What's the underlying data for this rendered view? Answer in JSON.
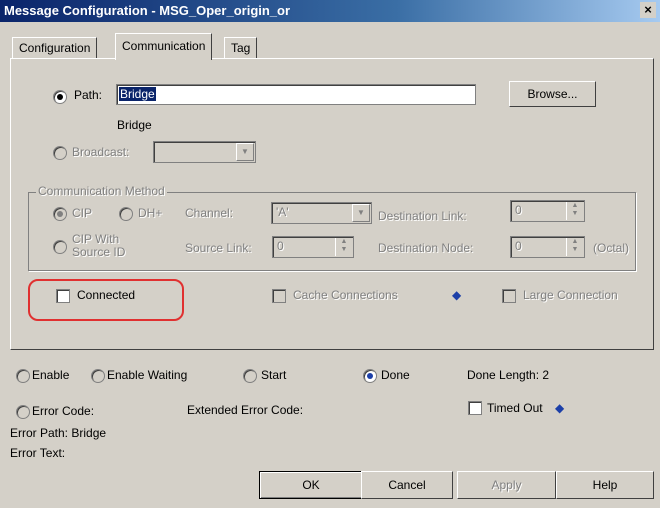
{
  "window": {
    "title": "Message Configuration - MSG_Oper_origin_or",
    "close_glyph": "×"
  },
  "tabs": [
    {
      "label": "Configuration"
    },
    {
      "label": "Communication"
    },
    {
      "label": "Tag"
    }
  ],
  "path": {
    "label": "Path:",
    "value": "Bridge",
    "resolved": "Bridge",
    "browse_label": "Browse..."
  },
  "broadcast": {
    "label": "Broadcast:"
  },
  "comm_method": {
    "group_label": "Communication Method",
    "cip_label": "CIP",
    "dhplus_label": "DH+",
    "cip_source_label_1": "CIP With",
    "cip_source_label_2": "Source ID",
    "channel_label": "Channel:",
    "channel_value": "'A'",
    "dest_link_label": "Destination Link:",
    "dest_link_value": "0",
    "source_link_label": "Source Link:",
    "source_link_value": "0",
    "dest_node_label": "Destination Node:",
    "dest_node_value": "0",
    "octal_label": "(Octal)"
  },
  "options": {
    "connected_label": "Connected",
    "cache_label": "Cache Connections",
    "large_label": "Large Connection"
  },
  "status": {
    "enable": "Enable",
    "enable_waiting": "Enable Waiting",
    "start": "Start",
    "done": "Done",
    "done_length": "Done Length: 2",
    "error_code": "Error Code:",
    "extended_error_code": "Extended Error Code:",
    "timed_out": "Timed Out",
    "error_path": "Error Path: Bridge",
    "error_text": "Error Text:"
  },
  "buttons": {
    "ok": "OK",
    "cancel": "Cancel",
    "apply": "Apply",
    "help": "Help"
  },
  "colors": {
    "highlight": "#e03030",
    "done_dot": "#1c3fa8",
    "title_bar": "#0a246a"
  }
}
